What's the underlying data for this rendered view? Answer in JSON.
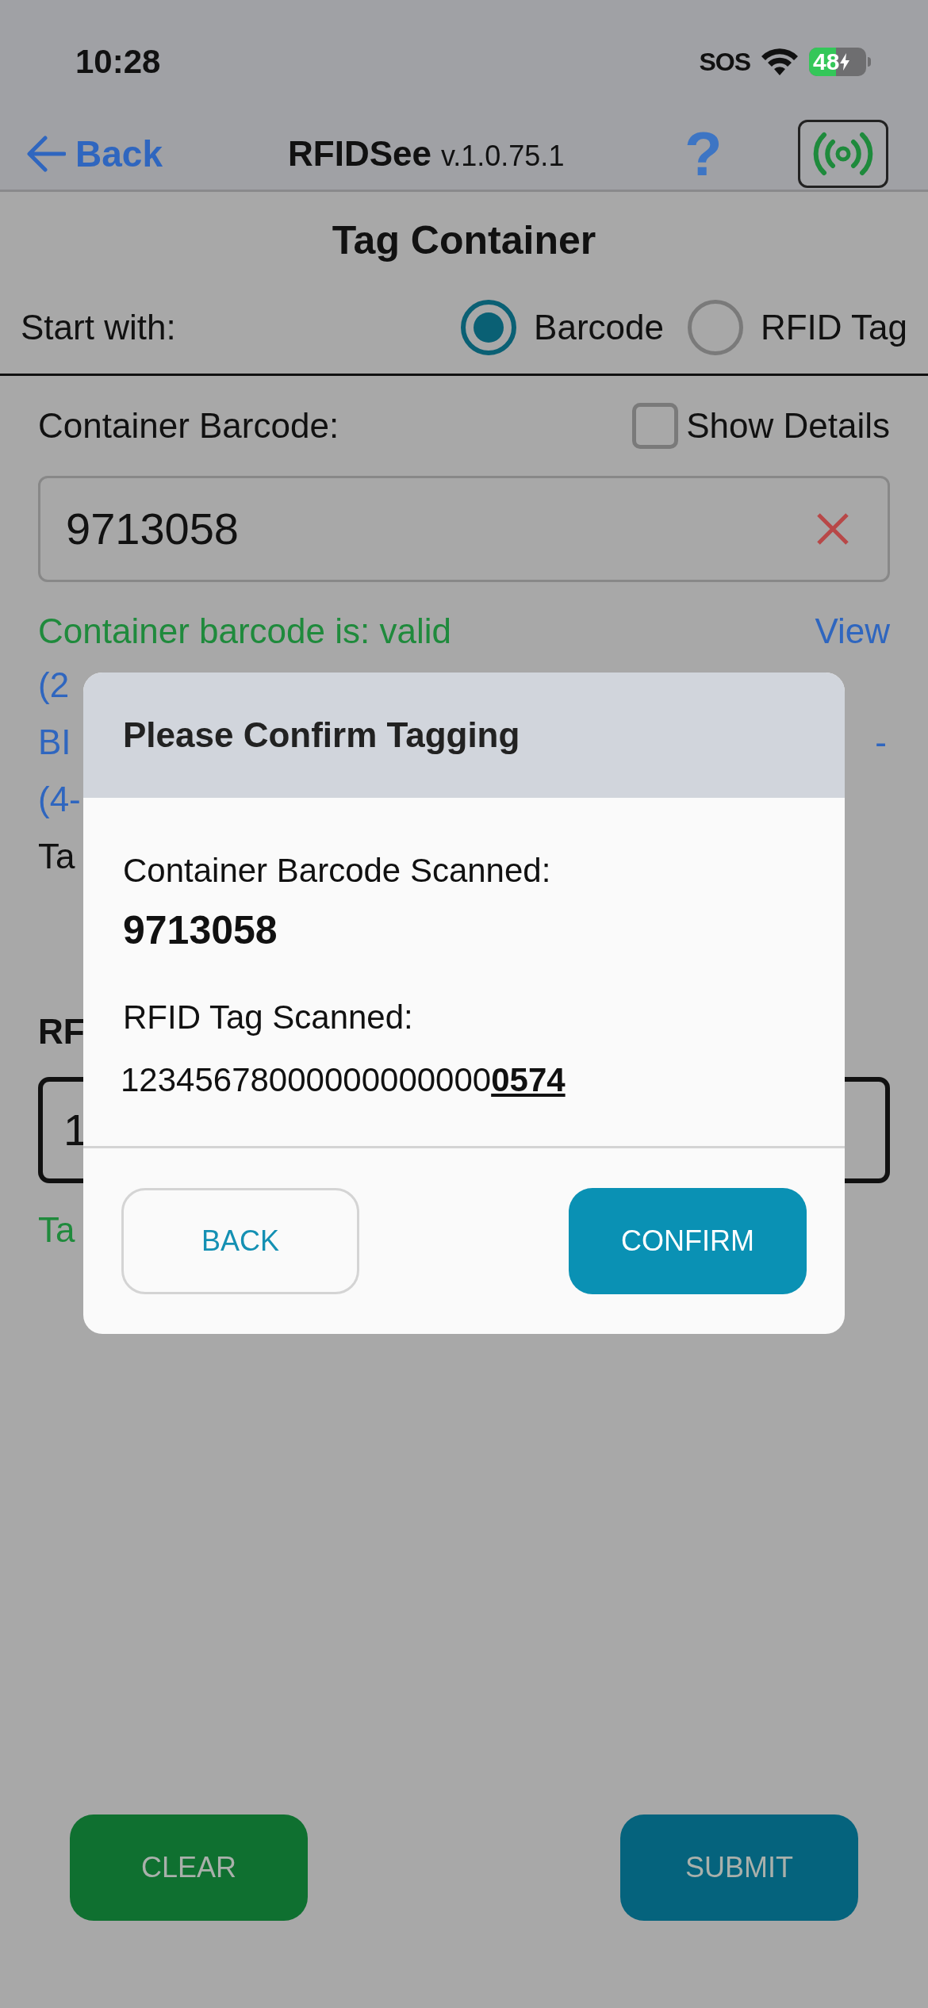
{
  "status_bar": {
    "time": "10:28",
    "sos": "SOS",
    "battery": "48"
  },
  "nav": {
    "back": "Back",
    "app_name": "RFIDSee",
    "version": "v.1.0.75.1",
    "help": "?"
  },
  "title": "Tag Container",
  "start_with": {
    "label": "Start with:",
    "options": [
      {
        "label": "Barcode",
        "selected": true
      },
      {
        "label": "RFID Tag",
        "selected": false
      }
    ]
  },
  "container_barcode": {
    "label": "Container Barcode:",
    "show_details": {
      "label": "Show Details",
      "checked": false
    },
    "value": "9713058",
    "status": "Container barcode is: valid",
    "view_link": "View"
  },
  "covered_lines": [
    {
      "left": "(2"
    },
    {
      "left": "BI",
      "right": "-"
    },
    {
      "left": "(4-"
    },
    {
      "left": "Ta"
    }
  ],
  "rfid": {
    "label": "RF",
    "value": "1",
    "status": "Ta"
  },
  "modal": {
    "title": "Please Confirm Tagging",
    "barcode_label": "Container Barcode Scanned:",
    "barcode_value": "9713058",
    "rfid_label": "RFID Tag Scanned:",
    "rfid_value": "12345678000000000000**0574**",
    "buttons": [
      {
        "label": "BACK",
        "kind": "outline"
      },
      {
        "label": "CONFIRM",
        "kind": "filled"
      }
    ]
  },
  "buttons": [
    {
      "label": "CLEAR",
      "kind": "clear"
    },
    {
      "label": "SUBMIT",
      "kind": "submit"
    }
  ]
}
